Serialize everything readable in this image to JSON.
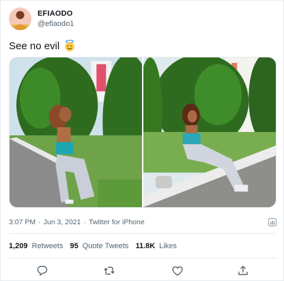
{
  "author": {
    "display_name": "EFIAODO",
    "handle": "@efiaodo1",
    "avatar": "avatar-photo"
  },
  "tweet": {
    "text": "See no evil",
    "emoji": "smiling-face-with-halo-emoji"
  },
  "media": {
    "count": 2,
    "items": [
      "photo-woman-crouching-by-hedge",
      "photo-woman-sitting-on-curb-by-hedge"
    ]
  },
  "meta": {
    "time": "3:07 PM",
    "separator": "·",
    "date": "Jun 3, 2021",
    "source": "Twitter for iPhone"
  },
  "stats": {
    "retweets": {
      "count": "1,209",
      "label": "Retweets"
    },
    "quotes": {
      "count": "95",
      "label": "Quote Tweets"
    },
    "likes": {
      "count": "11.8K",
      "label": "Likes"
    }
  },
  "actions": [
    "reply-icon",
    "retweet-icon",
    "like-icon",
    "share-icon"
  ],
  "colors": {
    "text": "#0f1419",
    "secondary": "#536471",
    "border": "#e6ecf0",
    "icon": "#536471"
  }
}
